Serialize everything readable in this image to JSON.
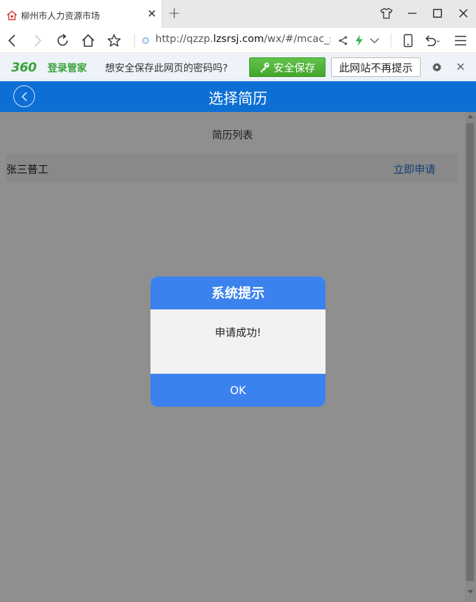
{
  "tab": {
    "title": "柳州市人力资源市场"
  },
  "address": {
    "scheme": "http://qzzp.",
    "host": "lzsrsj.com",
    "path": "/wx/#/mcac_sqz"
  },
  "password_bar": {
    "logo": "360",
    "product": "登录管家",
    "question": "想安全保存此网页的密码吗?",
    "save_label": "安全保存",
    "never_label": "此网站不再提示"
  },
  "page": {
    "header_title": "选择简历",
    "section_title": "简历列表",
    "resumes": [
      {
        "name": "张三普工",
        "action": "立即申请"
      }
    ]
  },
  "dialog": {
    "title": "系统提示",
    "message": "申请成功!",
    "ok_label": "OK"
  },
  "colors": {
    "header_blue": "#0d6fd4",
    "dialog_blue": "#3b82ee",
    "link_blue": "#1e6fd0",
    "brand_green": "#3aa23a"
  },
  "icons": {
    "tab": "favicon-icon",
    "nav": [
      "back-arrow-icon",
      "forward-arrow-icon",
      "refresh-icon",
      "home-icon",
      "star-icon"
    ],
    "url": [
      "share-icon",
      "lightning-icon",
      "chevron-down-icon"
    ],
    "tools": [
      "phone-icon",
      "undo-icon",
      "menu-icon"
    ],
    "window": [
      "skin-icon",
      "minimize-icon",
      "maximize-icon",
      "close-icon"
    ]
  }
}
